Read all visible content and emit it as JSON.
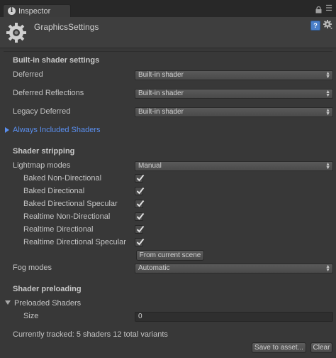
{
  "tab": {
    "label": "Inspector"
  },
  "header": {
    "title": "GraphicsSettings",
    "help_glyph": "?"
  },
  "builtin": {
    "title": "Built-in shader settings",
    "rows": [
      {
        "label": "Deferred",
        "value": "Built-in shader"
      },
      {
        "label": "Deferred Reflections",
        "value": "Built-in shader"
      },
      {
        "label": "Legacy Deferred",
        "value": "Built-in shader"
      }
    ]
  },
  "always_included": {
    "label": "Always Included Shaders"
  },
  "stripping": {
    "title": "Shader stripping",
    "lightmap": {
      "label": "Lightmap modes",
      "value": "Manual"
    },
    "modes": [
      {
        "label": "Baked Non-Directional",
        "checked": true
      },
      {
        "label": "Baked Directional",
        "checked": true
      },
      {
        "label": "Baked Directional Specular",
        "checked": true
      },
      {
        "label": "Realtime Non-Directional",
        "checked": true
      },
      {
        "label": "Realtime Directional",
        "checked": true
      },
      {
        "label": "Realtime Directional Specular",
        "checked": true
      }
    ],
    "from_scene_button": "From current scene",
    "fog": {
      "label": "Fog modes",
      "value": "Automatic"
    }
  },
  "preloading": {
    "title": "Shader preloading",
    "foldout": "Preloaded Shaders",
    "size_label": "Size",
    "size_value": "0"
  },
  "status": "Currently tracked: 5 shaders 12 total variants",
  "buttons": {
    "save": "Save to asset...",
    "clear": "Clear"
  },
  "colors": {
    "accent": "#5a8ff0",
    "background": "#383838"
  }
}
